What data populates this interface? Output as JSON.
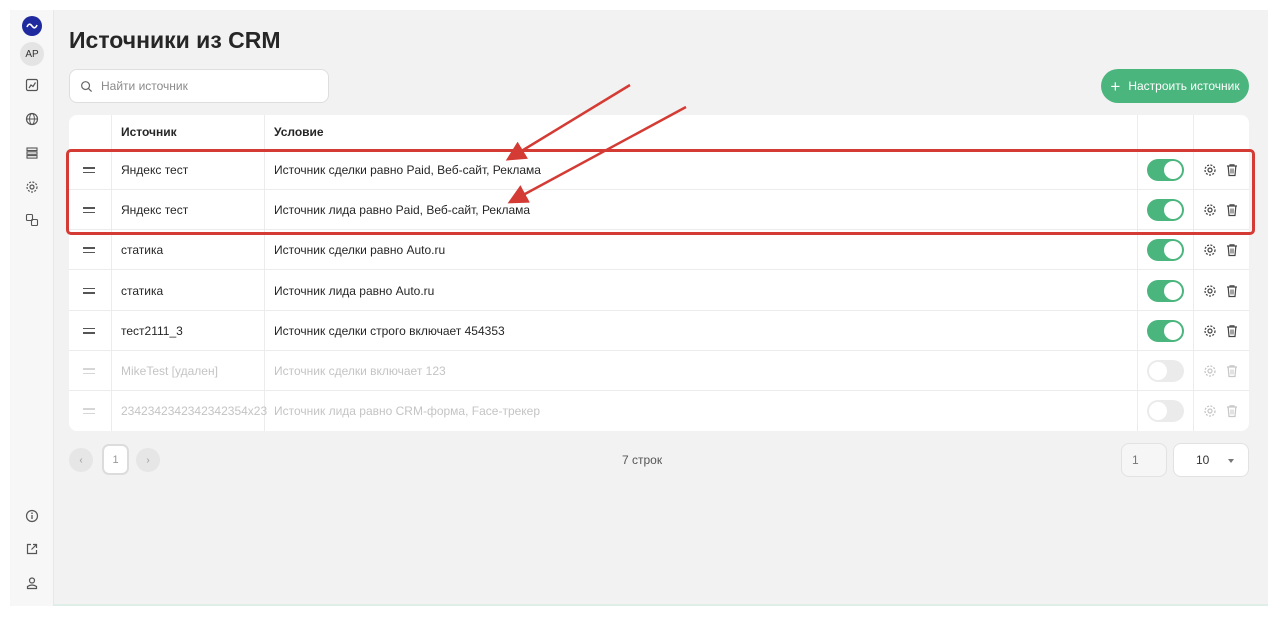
{
  "sidebar": {
    "avatar_initials": "АР",
    "icons": [
      "logo-icon",
      "analytics-icon",
      "globe-icon",
      "list-icon",
      "gear-icon",
      "sync-icon",
      "info-icon",
      "external-link-icon",
      "user-icon"
    ]
  },
  "page": {
    "title": "Источники из CRM"
  },
  "search": {
    "placeholder": "Найти источник"
  },
  "toolbar": {
    "add_label": "Настроить источник"
  },
  "table": {
    "headers": {
      "source": "Источник",
      "condition": "Условие"
    },
    "rows": [
      {
        "source": "Яндекс тест",
        "condition": "Источник сделки равно Paid, Веб-сайт, Реклама",
        "enabled": true,
        "deleted": false
      },
      {
        "source": "Яндекс тест",
        "condition": "Источник лида равно Paid, Веб-сайт, Реклама",
        "enabled": true,
        "deleted": false
      },
      {
        "source": "статика",
        "condition": "Источник сделки равно Auto.ru",
        "enabled": true,
        "deleted": false
      },
      {
        "source": "статика",
        "condition": "Источник лида равно Auto.ru",
        "enabled": true,
        "deleted": false
      },
      {
        "source": "тест2111_3",
        "condition": "Источник сделки строго включает 454353",
        "enabled": true,
        "deleted": false
      },
      {
        "source": "MikeTest [удален]",
        "condition": "Источник сделки включает 123",
        "enabled": false,
        "deleted": true
      },
      {
        "source": "2342342342342342354x23",
        "condition": "Источник лида равно CRM-форма, Face-трекер",
        "enabled": false,
        "deleted": true
      }
    ]
  },
  "pagination": {
    "prev": "‹",
    "current_page": "1",
    "next": "›",
    "rows_count": "7 строк",
    "page_input": "1",
    "per_page": "10"
  },
  "colors": {
    "accent": "#4bb57e",
    "annotation": "#d43b34",
    "logo": "#1f2a9e"
  }
}
